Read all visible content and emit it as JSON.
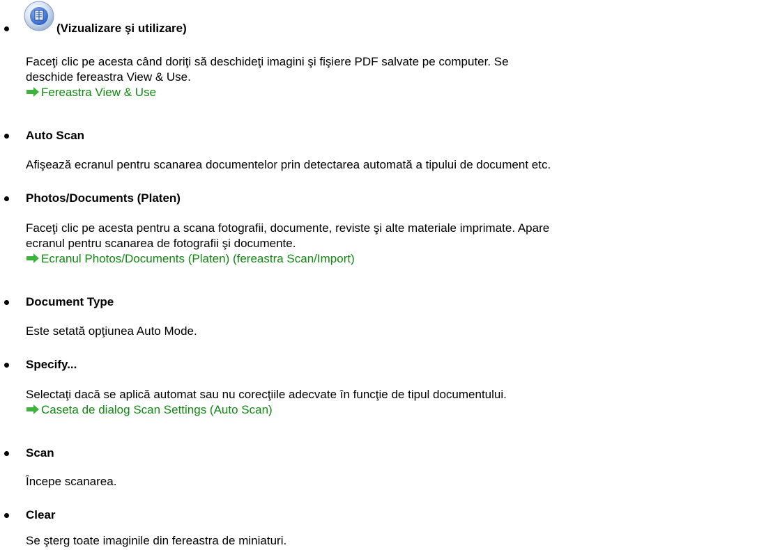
{
  "items": [
    {
      "title": "(Vizualizare şi utilizare)",
      "icon": "view-and-use-icon",
      "lines": [
        "Faceţi clic pe acesta când doriţi să deschideţi imagini şi fişiere PDF salvate pe computer. Se",
        "deschide fereastra View & Use."
      ],
      "link": "Fereastra View & Use"
    },
    {
      "title": "Auto Scan",
      "lines": [
        "Afişează ecranul pentru scanarea documentelor prin detectarea automată a tipului de document etc."
      ]
    },
    {
      "title": "Photos/Documents (Platen)",
      "lines": [
        "Faceţi clic pe acesta pentru a scana fotografii, documente, reviste şi alte materiale imprimate. Apare",
        "ecranul pentru scanarea de fotografii şi documente."
      ],
      "link": "Ecranul Photos/Documents (Platen) (fereastra Scan/Import)"
    },
    {
      "title": "Document Type",
      "lines": [
        "Este setată opţiunea Auto Mode."
      ]
    },
    {
      "title": "Specify...",
      "lines": [
        "Selectaţi dacă se aplică automat sau nu corecţiile adecvate în funcţie de tipul documentului."
      ],
      "link": "Caseta de dialog Scan Settings (Auto Scan)"
    },
    {
      "title": "Scan",
      "lines": [
        "Începe scanarea."
      ]
    },
    {
      "title": "Clear",
      "lines": [
        "Se şterg toate imaginile din fereastra de miniaturi."
      ]
    }
  ],
  "colors": {
    "link": "#118811",
    "arrow": "#3cb43c",
    "text": "#000000"
  }
}
